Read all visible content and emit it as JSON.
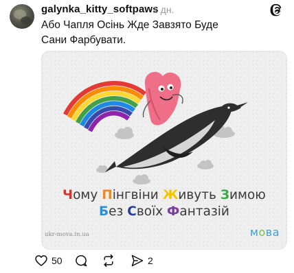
{
  "post": {
    "username": "galynka_kitty_softpaws",
    "time": "1 дн.",
    "text": "Або Чапля Осінь Жде Завзято Буде Сани Фарбувати."
  },
  "card": {
    "line1": [
      {
        "first": "Ч",
        "rest": "ому",
        "color": "#d9342b"
      },
      {
        "first": "П",
        "rest": "інгвіни",
        "color": "#f08a1c"
      },
      {
        "first": "Ж",
        "rest": "ивуть",
        "color": "#f2c500"
      },
      {
        "first": "З",
        "rest": "имою",
        "color": "#3aa845"
      }
    ],
    "line2": [
      {
        "first": "Б",
        "rest": "ез",
        "color": "#2a8fd4"
      },
      {
        "first": "С",
        "rest": "воїх",
        "color": "#283c9c"
      },
      {
        "first": "Ф",
        "rest": "антазій",
        "color": "#7a3f9d"
      }
    ],
    "site": "ukr-mova.in.ua",
    "logo_m": "м",
    "logo_o": "о",
    "logo_rest": "ва"
  },
  "actions": {
    "likes": "50",
    "shares": "2"
  },
  "colors": {
    "rainbow": [
      "#e53935",
      "#fb8c00",
      "#fdd835",
      "#43a047",
      "#1e88e5",
      "#3949ab",
      "#8e24aa"
    ],
    "heart": "#ef6f88",
    "penguin_body": "#2e2e2e",
    "penguin_belly": "#d6d6d6",
    "cloud": "#c4c4c4"
  }
}
